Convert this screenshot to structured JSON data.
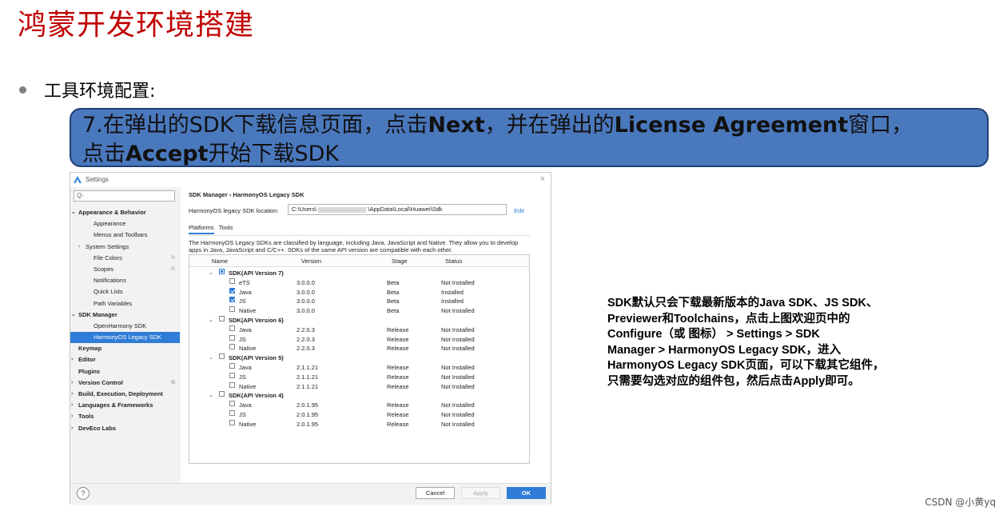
{
  "slide": {
    "title": "鸿蒙开发环境搭建",
    "bullet": "工具环境配置:",
    "step": {
      "p1": "7.在弹出的SDK下载信息页面，点击",
      "b1": "Next",
      "p2": "，并在弹出的",
      "b2": "License Agreement",
      "p3": "窗口，",
      "p4": "点击",
      "b3": "Accept",
      "p5": "开始下载SDK"
    },
    "note_lines": [
      "SDK默认只会下载最新版本的Java SDK、JS SDK、",
      "Previewer和Toolchains，点击上图欢迎页中的",
      "Configure（或      图标） > Settings > SDK",
      "Manager > HarmonyOS Legacy SDK，进入",
      "HarmonyOS Legacy SDK页面，可以下载其它组件，",
      "只需要勾选对应的组件包，然后点击Apply即可。"
    ],
    "credit": "CSDN @小黄yq"
  },
  "window": {
    "title": "Settings",
    "close": "×",
    "search_placeholder": "Q-",
    "sidebar": [
      {
        "label": "Appearance & Behavior",
        "bold": true,
        "arrow": "v",
        "indent": 0
      },
      {
        "label": "Appearance",
        "indent": 2
      },
      {
        "label": "Menus and Toolbars",
        "indent": 2
      },
      {
        "label": "System Settings",
        "indent": 1,
        "arrow": ">"
      },
      {
        "label": "File Colors",
        "indent": 2,
        "copy": true
      },
      {
        "label": "Scopes",
        "indent": 2,
        "copy": true
      },
      {
        "label": "Notifications",
        "indent": 2
      },
      {
        "label": "Quick Lists",
        "indent": 2
      },
      {
        "label": "Path Variables",
        "indent": 2
      },
      {
        "label": "SDK Manager",
        "bold": true,
        "arrow": "v",
        "indent": 0
      },
      {
        "label": "OpenHarmony SDK",
        "indent": 2
      },
      {
        "label": "HarmonyOS Legacy SDK",
        "indent": 2,
        "selected": true
      },
      {
        "label": "Keymap",
        "bold": true,
        "indent": 0
      },
      {
        "label": "Editor",
        "bold": true,
        "arrow": ">",
        "indent": 0
      },
      {
        "label": "Plugins",
        "bold": true,
        "indent": 0
      },
      {
        "label": "Version Control",
        "bold": true,
        "arrow": ">",
        "indent": 0,
        "copy": true
      },
      {
        "label": "Build, Execution, Deployment",
        "bold": true,
        "arrow": ">",
        "indent": 0
      },
      {
        "label": "Languages & Frameworks",
        "bold": true,
        "arrow": ">",
        "indent": 0
      },
      {
        "label": "Tools",
        "bold": true,
        "arrow": ">",
        "indent": 0
      },
      {
        "label": "DevEco Labs",
        "bold": true,
        "arrow": ">",
        "indent": 0
      }
    ],
    "breadcrumb": "SDK Manager  ›  HarmonyOS Legacy SDK",
    "location_label": "HarmonyOS legacy SDK location:",
    "location_prefix": "C:\\Users\\",
    "location_suffix": "\\AppData\\Local\\Huawei\\Sdk",
    "edit": "Edit",
    "tabs": [
      "Platforms",
      "Tools"
    ],
    "description": "The HarmonyOS Legacy SDKs are classified by language, including Java, JavaScript and Native. They allow you to develop apps in Java, JavaScript and C/C++. SDKs of the same API version are compatible with each other.",
    "columns": [
      "Name",
      "Version",
      "Stage",
      "Status"
    ],
    "groups": [
      {
        "name": "SDK(API Version 7)",
        "state": "part",
        "items": [
          {
            "name": "eTS",
            "version": "3.0.0.0",
            "stage": "Beta",
            "status": "Not Installed",
            "checked": false
          },
          {
            "name": "Java",
            "version": "3.0.0.0",
            "stage": "Beta",
            "status": "Installed",
            "checked": true
          },
          {
            "name": "JS",
            "version": "3.0.0.0",
            "stage": "Beta",
            "status": "Installed",
            "checked": true
          },
          {
            "name": "Native",
            "version": "3.0.0.0",
            "stage": "Beta",
            "status": "Not Installed",
            "checked": false
          }
        ]
      },
      {
        "name": "SDK(API Version 6)",
        "state": "off",
        "items": [
          {
            "name": "Java",
            "version": "2.2.0.3",
            "stage": "Release",
            "status": "Not Installed",
            "checked": false
          },
          {
            "name": "JS",
            "version": "2.2.0.3",
            "stage": "Release",
            "status": "Not Installed",
            "checked": false
          },
          {
            "name": "Native",
            "version": "2.2.0.3",
            "stage": "Release",
            "status": "Not Installed",
            "checked": false
          }
        ]
      },
      {
        "name": "SDK(API Version 5)",
        "state": "off",
        "items": [
          {
            "name": "Java",
            "version": "2.1.1.21",
            "stage": "Release",
            "status": "Not Installed",
            "checked": false
          },
          {
            "name": "JS",
            "version": "2.1.1.21",
            "stage": "Release",
            "status": "Not Installed",
            "checked": false
          },
          {
            "name": "Native",
            "version": "2.1.1.21",
            "stage": "Release",
            "status": "Not Installed",
            "checked": false
          }
        ]
      },
      {
        "name": "SDK(API Version 4)",
        "state": "off",
        "items": [
          {
            "name": "Java",
            "version": "2.0.1.95",
            "stage": "Release",
            "status": "Not Installed",
            "checked": false
          },
          {
            "name": "JS",
            "version": "2.0.1.95",
            "stage": "Release",
            "status": "Not Installed",
            "checked": false
          },
          {
            "name": "Native",
            "version": "2.0.1.95",
            "stage": "Release",
            "status": "Not Installed",
            "checked": false
          }
        ]
      }
    ],
    "buttons": {
      "help": "?",
      "cancel": "Cancel",
      "apply": "Apply",
      "ok": "OK"
    }
  }
}
